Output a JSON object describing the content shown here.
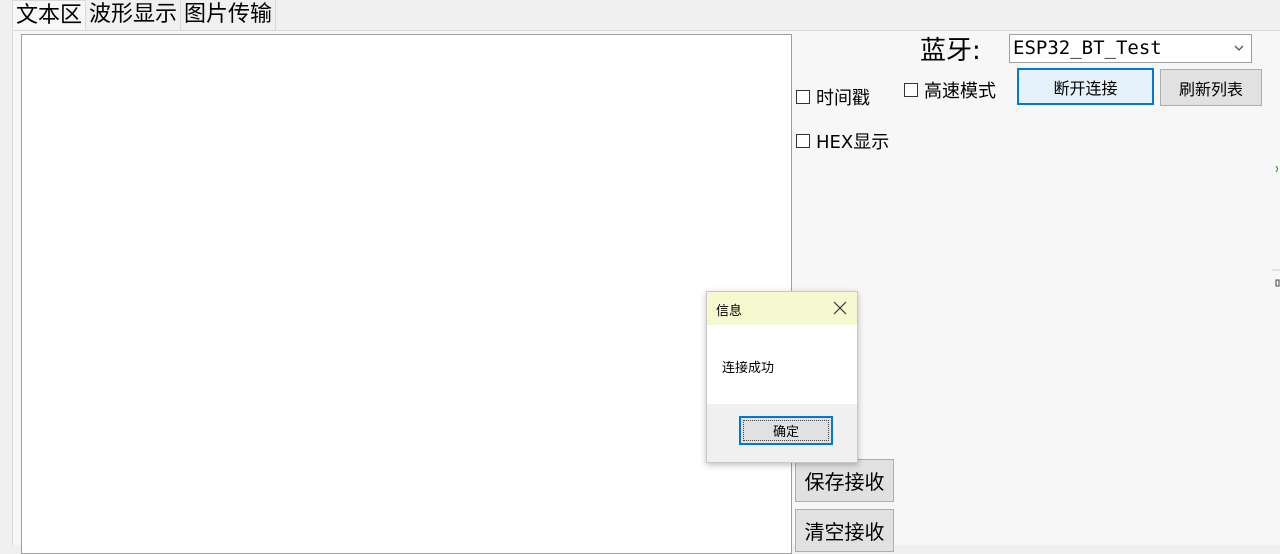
{
  "tabs": [
    {
      "label": "文本区",
      "active": true
    },
    {
      "label": "波形显示",
      "active": false
    },
    {
      "label": "图片传输",
      "active": false
    }
  ],
  "options": {
    "timestamp_label": "时间戳",
    "hex_label": "HEX显示",
    "timestamp_checked": false,
    "hex_checked": false
  },
  "receive_buttons": {
    "save": "保存接收",
    "clear": "清空接收"
  },
  "bluetooth": {
    "label": "蓝牙:",
    "device": "ESP32_BT_Test",
    "high_speed_label": "高速模式",
    "high_speed_checked": false,
    "disconnect": "断开连接",
    "refresh": "刷新列表"
  },
  "dialog": {
    "title": "信息",
    "message": "连接成功",
    "ok": "确定"
  },
  "colors": {
    "dialog_title_bg": "#f6f8cf",
    "focus_border": "#0078d7"
  }
}
